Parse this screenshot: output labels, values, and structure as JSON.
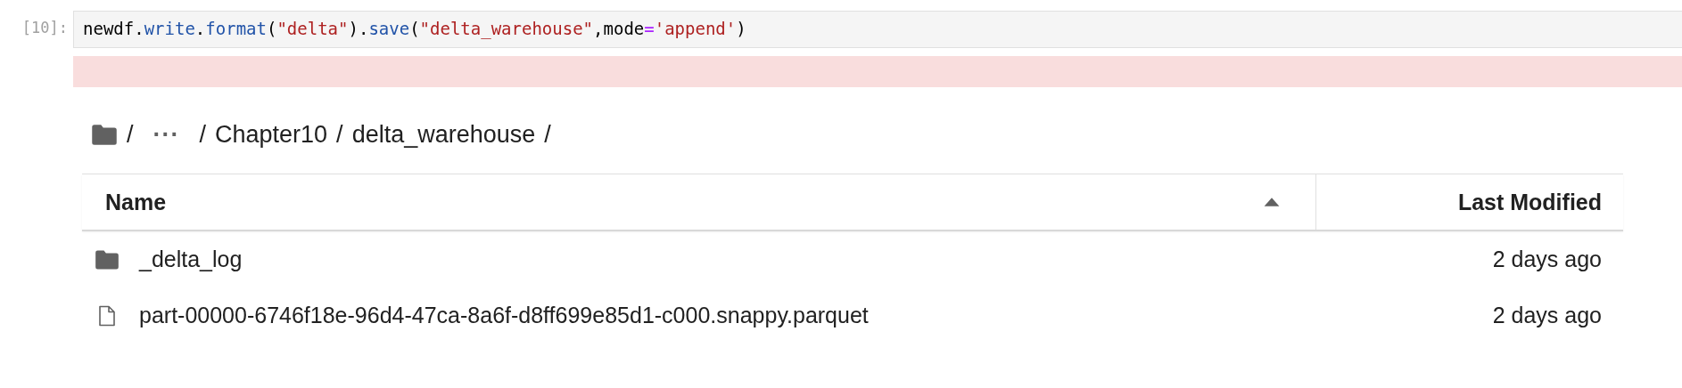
{
  "cell": {
    "prompt": "[10]:",
    "code": [
      {
        "kind": "name",
        "text": "newdf"
      },
      {
        "kind": "punct",
        "text": "."
      },
      {
        "kind": "attr",
        "text": "write"
      },
      {
        "kind": "punct",
        "text": "."
      },
      {
        "kind": "attr",
        "text": "format"
      },
      {
        "kind": "punct",
        "text": "("
      },
      {
        "kind": "string",
        "text": "\"delta\""
      },
      {
        "kind": "punct",
        "text": ")."
      },
      {
        "kind": "attr",
        "text": "save"
      },
      {
        "kind": "punct",
        "text": "("
      },
      {
        "kind": "string",
        "text": "\"delta_warehouse\""
      },
      {
        "kind": "punct",
        "text": ","
      },
      {
        "kind": "name",
        "text": "mode"
      },
      {
        "kind": "operator",
        "text": "="
      },
      {
        "kind": "string",
        "text": "'append'"
      },
      {
        "kind": "punct",
        "text": ")"
      }
    ],
    "output": {
      "kind": "error"
    }
  },
  "breadcrumb": [
    {
      "kind": "root",
      "sep": "/"
    },
    {
      "kind": "ellipsis",
      "label": "···",
      "sep": "/"
    },
    {
      "kind": "dir",
      "label": "Chapter10",
      "sep": "/"
    },
    {
      "kind": "dir",
      "label": "delta_warehouse",
      "sep": "/"
    }
  ],
  "table": {
    "columns": [
      {
        "label": "Name",
        "sorted": true
      },
      {
        "label": "Last Modified",
        "sorted": false
      }
    ],
    "rows": [
      {
        "kind": "folder",
        "name": "_delta_log",
        "modified": "2 days ago"
      },
      {
        "kind": "file",
        "name": "part-00000-6746f18e-96d4-47ca-8a6f-d8ff699e85d1-c000.snappy.parquet",
        "modified": "2 days ago"
      }
    ]
  }
}
